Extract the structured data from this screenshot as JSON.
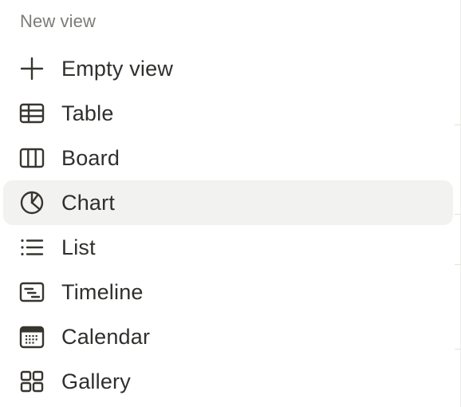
{
  "menu": {
    "section_label": "New view",
    "items": [
      {
        "label": "Empty view",
        "icon": "plus-icon"
      },
      {
        "label": "Table",
        "icon": "table-icon"
      },
      {
        "label": "Board",
        "icon": "board-icon"
      },
      {
        "label": "Chart",
        "icon": "chart-pie-icon",
        "highlighted": true
      },
      {
        "label": "List",
        "icon": "list-icon"
      },
      {
        "label": "Timeline",
        "icon": "timeline-icon"
      },
      {
        "label": "Calendar",
        "icon": "calendar-icon"
      },
      {
        "label": "Gallery",
        "icon": "gallery-icon"
      }
    ]
  },
  "colors": {
    "text": "#2f2f2d",
    "section_label": "#7d7c78",
    "highlight_bg": "#f2f2f0",
    "icon": "#37352f"
  }
}
